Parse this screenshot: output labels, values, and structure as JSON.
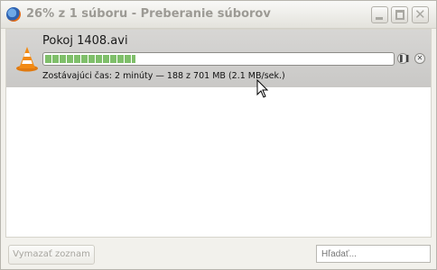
{
  "window": {
    "title": "26% z 1 súboru - Preberanie súborov",
    "app_icon": "firefox-icon"
  },
  "download": {
    "file_name": "Pokoj 1408.avi",
    "file_icon": "vlc-cone-icon",
    "progress_fraction": 0.26,
    "status": "Zostávajúci čas: 2 minúty — 188 z 701 MB (2.1 MB/sek.)",
    "pause_icon": "pause-icon",
    "cancel_icon": "close-icon"
  },
  "footer": {
    "clear_button_label": "Vymazať zoznam",
    "search_placeholder": "Hľadať..."
  },
  "colors": {
    "progress_fill": "#7fbf6a",
    "item_background": "#c9c8c6"
  }
}
